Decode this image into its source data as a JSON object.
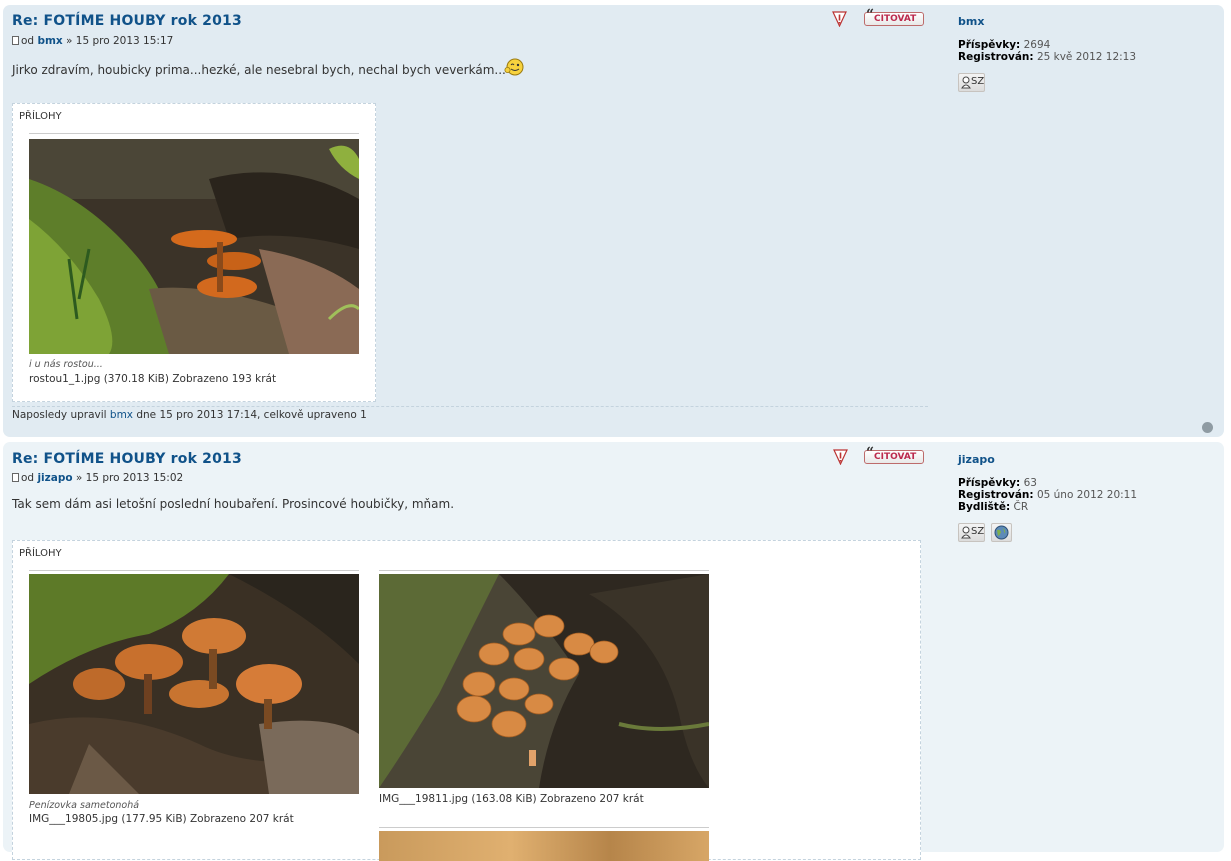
{
  "posts": [
    {
      "title": "Re: FOTÍME HOUBY rok 2013",
      "author_prefix": "od",
      "author": "bmx",
      "date": "» 15 pro 2013 15:17",
      "body": "Jirko zdravím, houbicky prima...hezké, ale nesebral bych, nechal bych veverkám...",
      "quote_label": "CITOVAT",
      "attachments_title": "PŘÍLOHY",
      "attachments": [
        {
          "caption": "i u nás rostou...",
          "fileinfo": "rostou1_1.jpg (370.18 KiB) Zobrazeno 193 krát"
        }
      ],
      "edited_prefix": "Naposledy upravil",
      "edited_user": "bmx",
      "edited_suffix": "dne 15 pro 2013 17:14, celkově upraveno 1",
      "profile": {
        "name": "bmx",
        "posts_label": "Příspěvky:",
        "posts_value": "2694",
        "registered_label": "Registrován:",
        "registered_value": "25 kvě 2012 12:13",
        "pm_label": "SZ"
      }
    },
    {
      "title": "Re: FOTÍME HOUBY rok 2013",
      "author_prefix": "od",
      "author": "jizapo",
      "date": "» 15 pro 2013 15:02",
      "body": "Tak sem dám asi letošní poslední houbaření. Prosincové houbičky, mňam.",
      "quote_label": "CITOVAT",
      "attachments_title": "PŘÍLOHY",
      "attachments": [
        {
          "caption": "Penízovka sametonohá",
          "fileinfo": "IMG___19805.jpg (177.95 KiB) Zobrazeno 207 krát"
        },
        {
          "caption": "",
          "fileinfo": "IMG___19811.jpg (163.08 KiB) Zobrazeno 207 krát"
        }
      ],
      "profile": {
        "name": "jizapo",
        "posts_label": "Příspěvky:",
        "posts_value": "63",
        "registered_label": "Registrován:",
        "registered_value": "05 úno 2012 20:11",
        "location_label": "Bydliště:",
        "location_value": "ČR",
        "pm_label": "SZ"
      }
    }
  ],
  "colors": {
    "post_bg_1": "#e1ebf2",
    "post_bg_2": "#ecf3f7",
    "link": "#105289",
    "quote_text": "#bc2a4d"
  },
  "icons": [
    "report-icon",
    "quote-icon",
    "post-icon",
    "wink-emoji-icon",
    "pm-contact-icon",
    "website-globe-icon",
    "back-to-top-icon"
  ]
}
